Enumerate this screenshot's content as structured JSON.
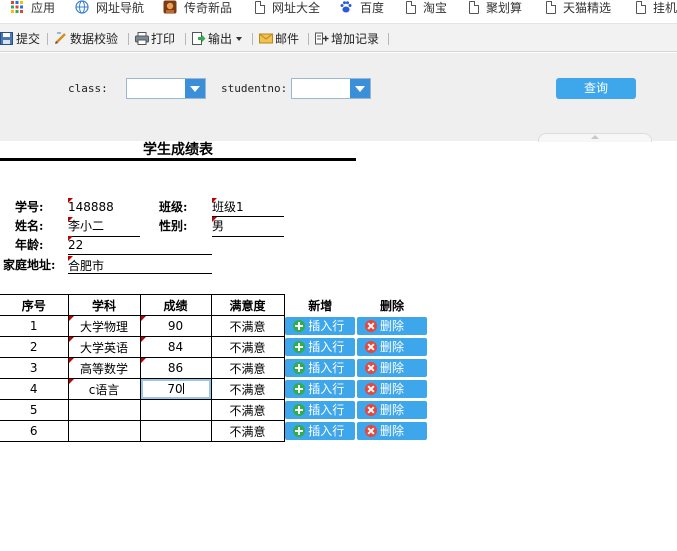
{
  "bookmarks": [
    {
      "label": "应用",
      "icon": "apps-grid-icon"
    },
    {
      "label": "网址导航",
      "icon": "globe-icon"
    },
    {
      "label": "传奇新品",
      "icon": "game-avatar-icon"
    },
    {
      "label": "网址大全",
      "icon": "page-icon"
    },
    {
      "label": "百度",
      "icon": "baidu-paw-icon"
    },
    {
      "label": "淘宝",
      "icon": "page-icon"
    },
    {
      "label": "聚划算",
      "icon": "page-icon"
    },
    {
      "label": "天猫精选",
      "icon": "page-icon"
    },
    {
      "label": "挂机",
      "icon": "page-icon"
    }
  ],
  "toolbar": {
    "submit": "提交",
    "validate": "数据校验",
    "print": "打印",
    "export": "输出",
    "mail": "邮件",
    "add_record": "增加记录"
  },
  "query": {
    "class_label": "class:",
    "studentno_label": "studentno:",
    "class_value": "",
    "studentno_value": "",
    "button": "查询"
  },
  "report": {
    "title": "学生成绩表",
    "labels": {
      "student_no": "学号:",
      "class": "班级:",
      "name": "姓名:",
      "gender": "性别:",
      "age": "年龄:",
      "address": "家庭地址:"
    },
    "values": {
      "student_no": "148888",
      "class": "班级1",
      "name": "李小二",
      "gender": "男",
      "age": "22",
      "address": "合肥市"
    }
  },
  "table": {
    "headers": [
      "序号",
      "学科",
      "成绩",
      "满意度",
      "新增",
      "删除"
    ],
    "rows": [
      {
        "no": "1",
        "subject": "大学物理",
        "score": "90",
        "satisfaction": "不满意"
      },
      {
        "no": "2",
        "subject": "大学英语",
        "score": "84",
        "satisfaction": "不满意"
      },
      {
        "no": "3",
        "subject": "高等数学",
        "score": "86",
        "satisfaction": "不满意"
      },
      {
        "no": "4",
        "subject": "c语言",
        "score": "70",
        "satisfaction": "不满意"
      },
      {
        "no": "5",
        "subject": "",
        "score": "",
        "satisfaction": "不满意"
      },
      {
        "no": "6",
        "subject": "",
        "score": "",
        "satisfaction": "不满意"
      }
    ],
    "insert_label": "插入行",
    "delete_label": "删除"
  },
  "colors": {
    "button_blue": "#3ea6ea",
    "combo_arrow": "#3b8fd9",
    "plus_green": "#2fae4c",
    "delete_red": "#e8453c",
    "cell_tick_red": "#c00000"
  }
}
